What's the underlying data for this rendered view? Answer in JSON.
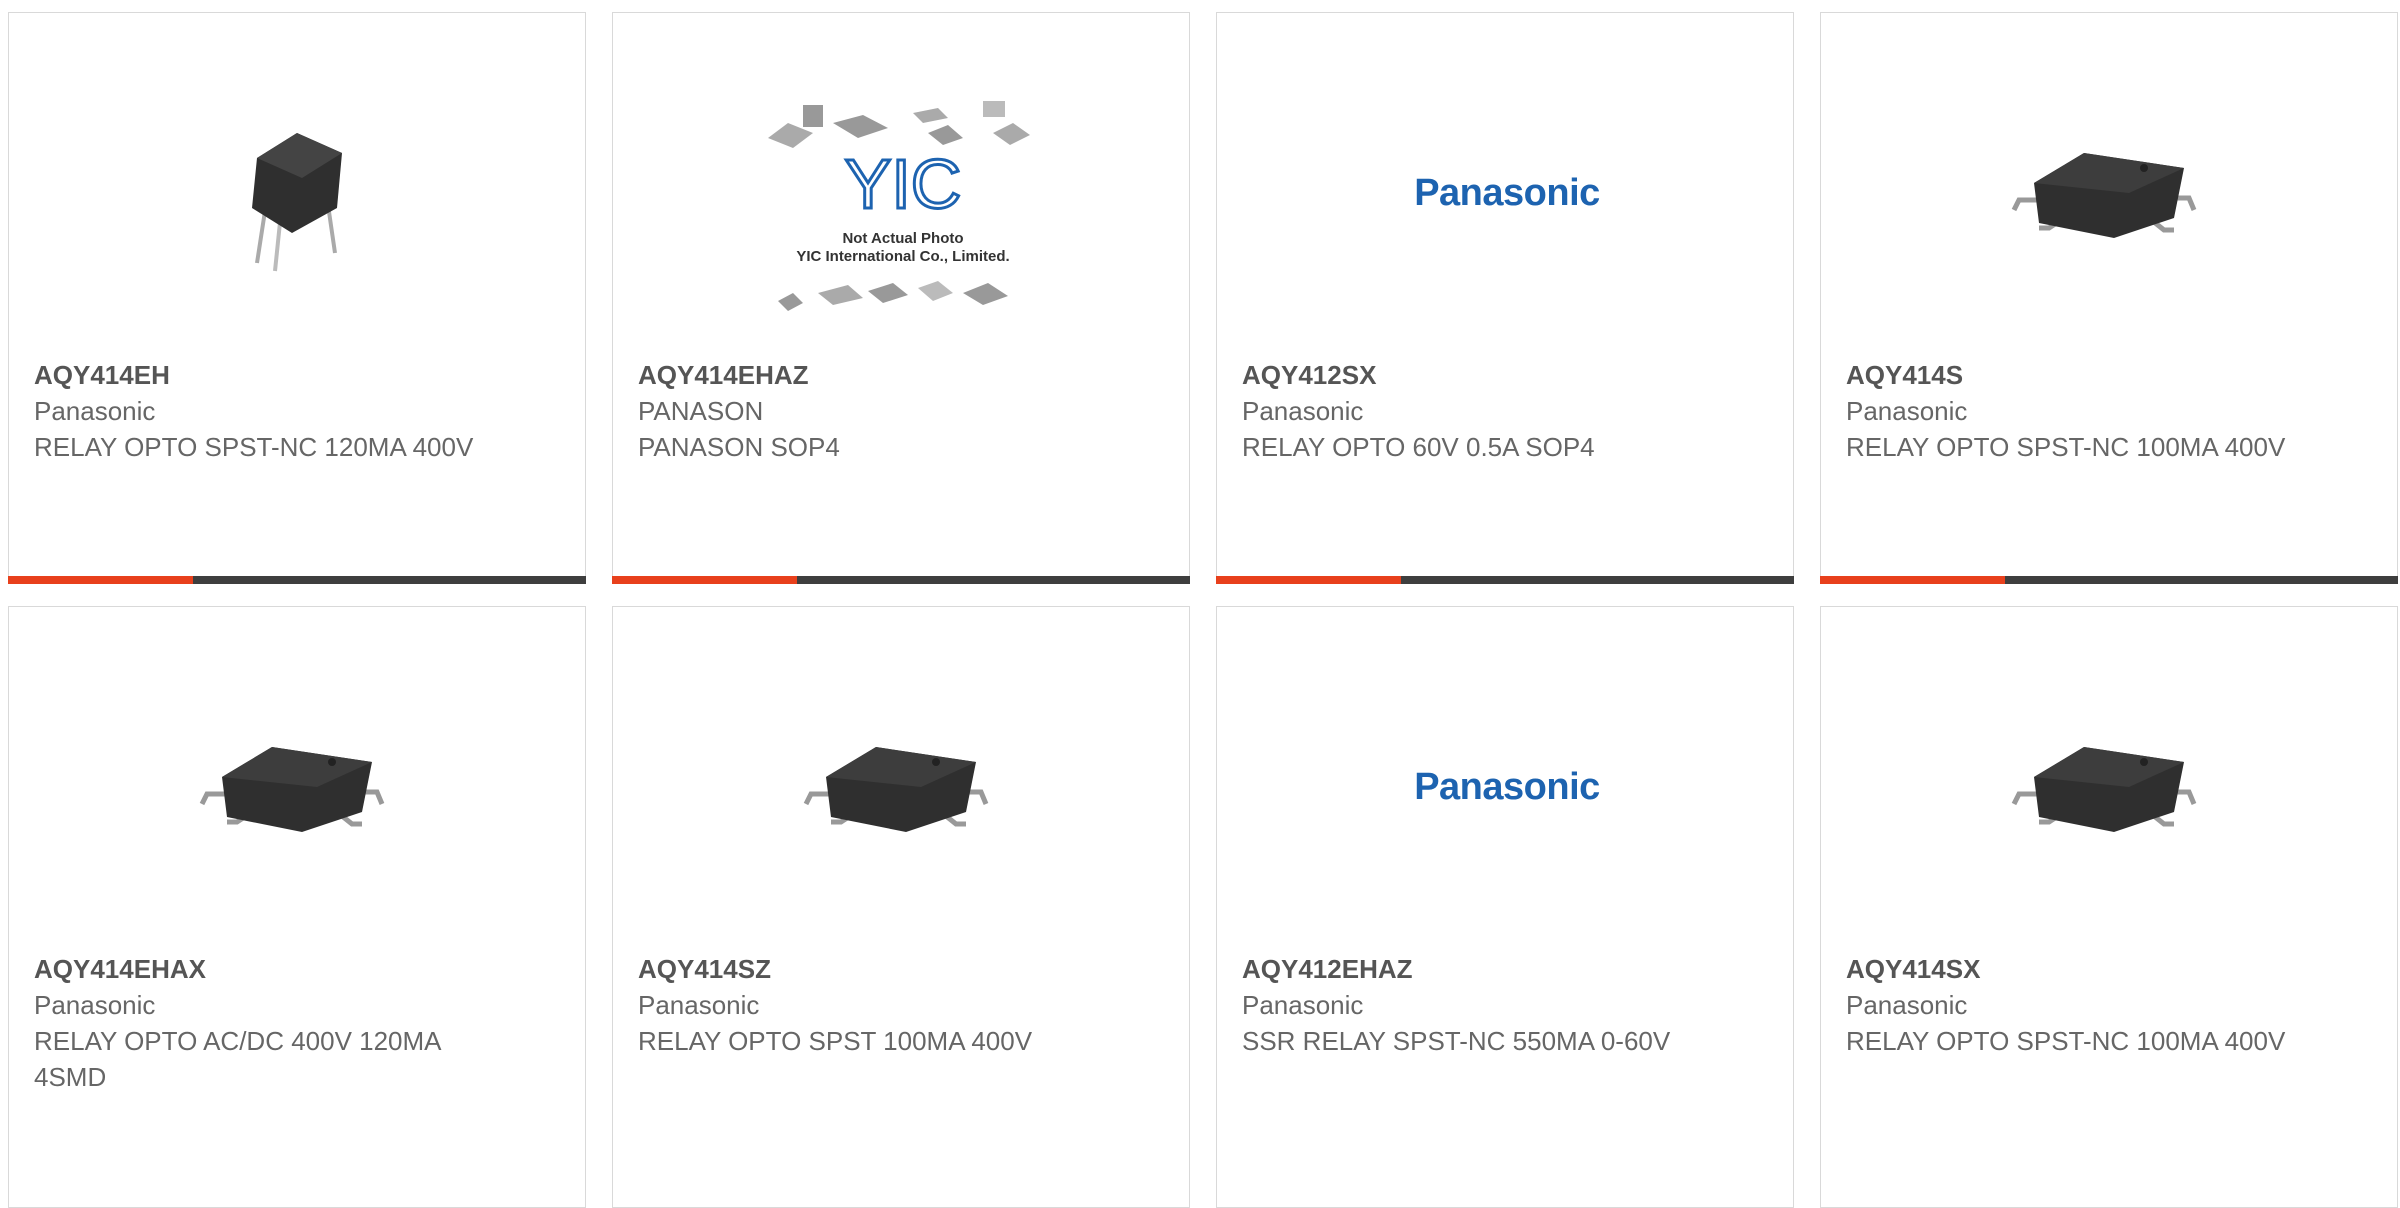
{
  "products": [
    {
      "part_number": "AQY414EH",
      "manufacturer": "Panasonic",
      "description": "RELAY OPTO SPST-NC 120MA 400V",
      "image": "dip4-relay-photo",
      "bar_fill_fraction": 0.32
    },
    {
      "part_number": "AQY414EHAZ",
      "manufacturer": "PANASON",
      "description": "PANASON SOP4",
      "image": "yic-placeholder",
      "placeholder_brand": "YIC",
      "placeholder_line1": "Not Actual Photo",
      "placeholder_line2": "YIC International Co., Limited.",
      "bar_fill_fraction": 0.32
    },
    {
      "part_number": "AQY412SX",
      "manufacturer": "Panasonic",
      "description": "RELAY OPTO 60V 0.5A SOP4",
      "image": "panasonic-logo",
      "logo_text": "Panasonic",
      "bar_fill_fraction": 0.32
    },
    {
      "part_number": "AQY414S",
      "manufacturer": "Panasonic",
      "description": "RELAY OPTO SPST-NC 100MA 400V",
      "image": "smd4-relay-photo",
      "bar_fill_fraction": 0.32
    },
    {
      "part_number": "AQY414EHAX",
      "manufacturer": "Panasonic",
      "description": "RELAY OPTO AC/DC 400V 120MA 4SMD",
      "image": "smd4-relay-photo"
    },
    {
      "part_number": "AQY414SZ",
      "manufacturer": "Panasonic",
      "description": "RELAY OPTO SPST 100MA 400V",
      "image": "smd4-relay-photo"
    },
    {
      "part_number": "AQY412EHAZ",
      "manufacturer": "Panasonic",
      "description": "SSR RELAY SPST-NC 550MA 0-60V",
      "image": "panasonic-logo",
      "logo_text": "Panasonic"
    },
    {
      "part_number": "AQY414SX",
      "manufacturer": "Panasonic",
      "description": "RELAY OPTO SPST-NC 100MA 400V",
      "image": "smd4-relay-photo"
    }
  ],
  "colors": {
    "accent": "#e8401c",
    "bar": "#3e3e3e",
    "part_number": "#555555",
    "text": "#666666",
    "border": "#d9d9d9",
    "logo": "#1d63b0"
  }
}
